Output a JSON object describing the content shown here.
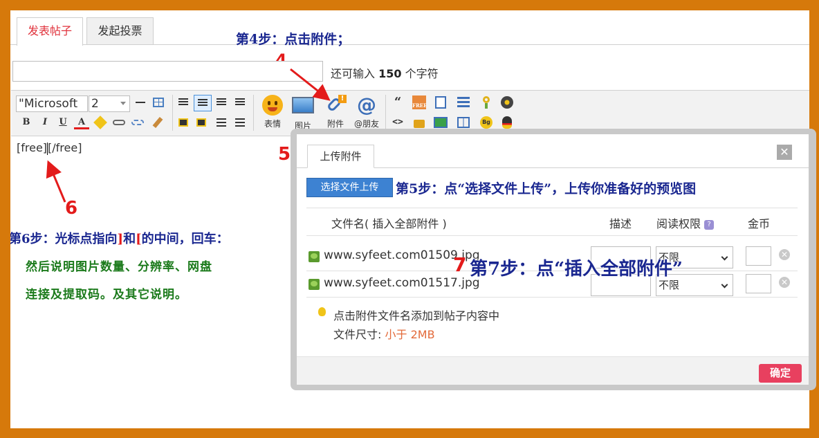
{
  "tabs": {
    "post": "发表帖子",
    "poll": "发起投票"
  },
  "steps": {
    "step4": "第4步：点击附件；",
    "step5": "第5步：点“选择文件上传”，上传你准备好的预览图",
    "step6_prefix": "第6步：光标点指向",
    "step6_rb": "]",
    "step6_and": "和",
    "step6_lb": "[",
    "step6_suffix": "的中间，回车：",
    "step6_line2": "然后说明图片数量、分辨率、网盘",
    "step6_line3": "连接及提取码。及其它说明。",
    "step7": "第7步：点“插入全部附件”"
  },
  "markers": {
    "n4": "4",
    "n5": "5",
    "n6": "6",
    "n7": "7"
  },
  "title_input": {
    "value": "",
    "hint_prefix": "还可输入",
    "hint_count": "150",
    "hint_suffix": "个字符"
  },
  "toolbar": {
    "font_family": "\"Microsoft",
    "font_size": "2",
    "bold": "B",
    "italic": "I",
    "underline": "U",
    "color": "A",
    "emoji_label": "表情",
    "image_label": "图片",
    "attach_label": "附件",
    "at_label": "@朋友",
    "quote_glyph": "“",
    "code_glyph": "<>",
    "free_text": "FREE",
    "bg_text": "Bg"
  },
  "editor": {
    "content_before": "[free]",
    "content_after": "[/free]"
  },
  "dialog": {
    "tab": "上传附件",
    "close_glyph": "✕",
    "upload_button": "选择文件上传",
    "columns": {
      "name": "文件名",
      "insert_all_open": "( ",
      "insert_all": "插入全部附件",
      "insert_all_close": " )",
      "desc": "描述",
      "perm": "阅读权限",
      "gold": "金币"
    },
    "files": [
      {
        "name": "www.syfeet.com01509.jpg",
        "perm": "不限"
      },
      {
        "name": "www.syfeet.com01517.jpg",
        "perm": "不限"
      }
    ],
    "tip": "点击附件文件名添加到帖子内容中",
    "size_label": "文件尺寸:",
    "size_value": "小于 2MB",
    "ok_button": "确定"
  },
  "colors": {
    "frame": "#d6790b",
    "step_text": "#1a2790",
    "marker": "#e31b1b",
    "note_text": "#1b7a1b",
    "upload_button": "#3d82d2",
    "ok_button": "#e8405f"
  }
}
